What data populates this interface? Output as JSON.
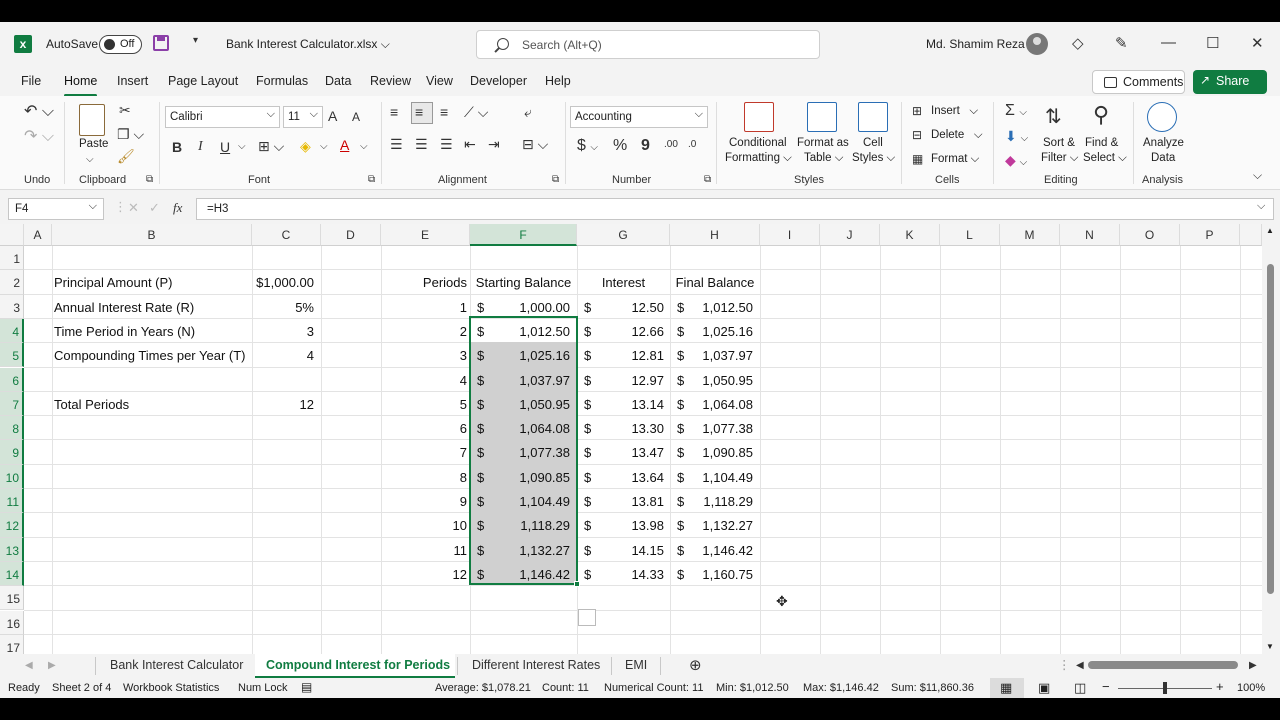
{
  "titlebar": {
    "app_icon": "excel-icon",
    "autosave_label": "AutoSave",
    "autosave_state": "Off",
    "file_name": "Bank Interest Calculator.xlsx",
    "search_placeholder": "Search (Alt+Q)",
    "user_name": "Md. Shamim Reza"
  },
  "menu": {
    "tabs": [
      "File",
      "Home",
      "Insert",
      "Page Layout",
      "Formulas",
      "Data",
      "Review",
      "View",
      "Developer",
      "Help"
    ],
    "active": "Home",
    "comments_label": "Comments",
    "share_label": "Share"
  },
  "ribbon": {
    "groups": [
      "Undo",
      "Clipboard",
      "Font",
      "Alignment",
      "Number",
      "Styles",
      "Cells",
      "Editing",
      "Analysis"
    ],
    "paste_label": "Paste",
    "font_name": "Calibri",
    "font_size": "11",
    "number_format": "Accounting",
    "styles": {
      "conditional_line1": "Conditional",
      "conditional_line2": "Formatting",
      "format_table_line1": "Format as",
      "format_table_line2": "Table",
      "cell_styles_line1": "Cell",
      "cell_styles_line2": "Styles"
    },
    "cells": {
      "insert": "Insert",
      "delete": "Delete",
      "format": "Format"
    },
    "editing": {
      "sort_line1": "Sort &",
      "sort_line2": "Filter",
      "find_line1": "Find &",
      "find_line2": "Select"
    },
    "analysis": {
      "line1": "Analyze",
      "line2": "Data"
    },
    "font_buttons": {
      "bold": "B",
      "italic": "I",
      "underline": "U"
    },
    "number_buttons": {
      "currency": "$",
      "percent": "%",
      "comma": "9"
    }
  },
  "formula_bar": {
    "name_box": "F4",
    "fx": "fx",
    "formula": "=H3"
  },
  "grid": {
    "columns": [
      "A",
      "B",
      "C",
      "D",
      "E",
      "F",
      "G",
      "H",
      "I",
      "J",
      "K",
      "L",
      "M",
      "N",
      "O",
      "P"
    ],
    "selected_column": "F",
    "rows": [
      "1",
      "2",
      "3",
      "4",
      "5",
      "6",
      "7",
      "8",
      "9",
      "10",
      "11",
      "12",
      "13",
      "14",
      "15",
      "16",
      "17"
    ],
    "inputs": [
      {
        "label": "Principal Amount (P)",
        "value": "$1,000.00"
      },
      {
        "label": "Annual Interest Rate (R)",
        "value": "5%"
      },
      {
        "label": "Time Period in Years (N)",
        "value": "3"
      },
      {
        "label": "Compounding Times per Year (T)",
        "value": "4"
      },
      {
        "label": "",
        "value": ""
      },
      {
        "label": "Total Periods",
        "value": "12"
      }
    ],
    "table_headers": [
      "Periods",
      "Starting Balance",
      "Interest",
      "Final Balance"
    ],
    "table_rows": [
      {
        "period": "1",
        "start": "1,000.00",
        "interest": "12.50",
        "final": "1,012.50"
      },
      {
        "period": "2",
        "start": "1,012.50",
        "interest": "12.66",
        "final": "1,025.16"
      },
      {
        "period": "3",
        "start": "1,025.16",
        "interest": "12.81",
        "final": "1,037.97"
      },
      {
        "period": "4",
        "start": "1,037.97",
        "interest": "12.97",
        "final": "1,050.95"
      },
      {
        "period": "5",
        "start": "1,050.95",
        "interest": "13.14",
        "final": "1,064.08"
      },
      {
        "period": "6",
        "start": "1,064.08",
        "interest": "13.30",
        "final": "1,077.38"
      },
      {
        "period": "7",
        "start": "1,077.38",
        "interest": "13.47",
        "final": "1,090.85"
      },
      {
        "period": "8",
        "start": "1,090.85",
        "interest": "13.64",
        "final": "1,104.49"
      },
      {
        "period": "9",
        "start": "1,104.49",
        "interest": "13.81",
        "final": "1,118.29"
      },
      {
        "period": "10",
        "start": "1,118.29",
        "interest": "13.98",
        "final": "1,132.27"
      },
      {
        "period": "11",
        "start": "1,132.27",
        "interest": "14.15",
        "final": "1,146.42"
      },
      {
        "period": "12",
        "start": "1,146.42",
        "interest": "14.33",
        "final": "1,160.75"
      }
    ],
    "currency_symbol": "$"
  },
  "sheets": {
    "tabs": [
      "Bank Interest Calculator",
      "Compound Interest for Periods",
      "Different Interest Rates",
      "EMI"
    ],
    "active": "Compound Interest for Periods"
  },
  "status": {
    "ready": "Ready",
    "sheet_info": "Sheet 2 of 4",
    "workbook_stats": "Workbook Statistics",
    "num_lock": "Num Lock",
    "average": "Average: $1,078.21",
    "count": "Count: 11",
    "numerical_count": "Numerical Count: 11",
    "min": "Min: $1,012.50",
    "max": "Max: $1,146.42",
    "sum": "Sum: $11,860.36",
    "zoom": "100%"
  },
  "colors": {
    "accent": "#107c41",
    "selection_fill": "#d0d0d0"
  }
}
